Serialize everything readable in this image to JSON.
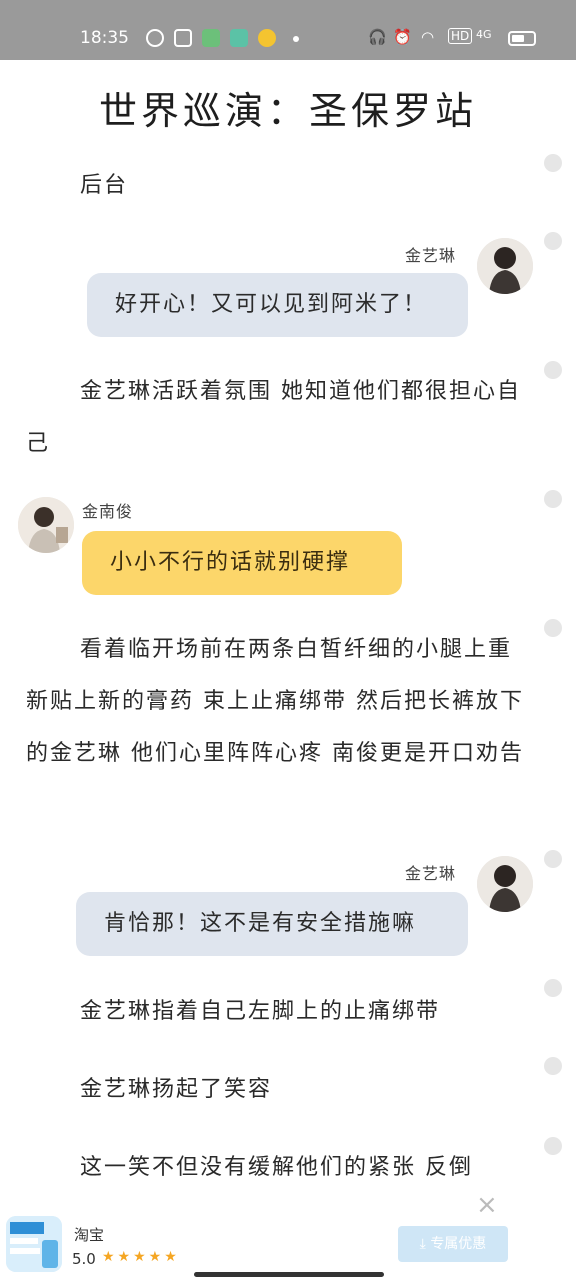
{
  "status_bar": {
    "time": "18:35",
    "network": "HD",
    "signal": "4G"
  },
  "title": "世界巡演：圣保罗站",
  "narrative": {
    "p1": "后台",
    "p2": "金艺琳活跃着氛围 她知道他们都很担心自己",
    "p3": "看着临开场前在两条白皙纤细的小腿上重新贴上新的膏药 束上止痛绑带 然后把长裤放下的金艺琳 他们心里阵阵心疼 南俊更是开口劝告",
    "p4": "金艺琳指着自己左脚上的止痛绑带",
    "p5": "金艺琳扬起了笑容",
    "p6": "这一笑不但没有缓解他们的紧张 反倒"
  },
  "messages": [
    {
      "speaker": "金艺琳",
      "text": "好开心！又可以见到阿米了！",
      "side": "right"
    },
    {
      "speaker": "金南俊",
      "text": "小小不行的话就别硬撑",
      "side": "left"
    },
    {
      "speaker": "金艺琳",
      "text": "肯恰那！这不是有安全措施嘛",
      "side": "right"
    }
  ],
  "ad": {
    "app_name": "淘宝",
    "rating": "5.0",
    "button_label": "专属优惠",
    "close": "×"
  },
  "colors": {
    "right_bubble": "#dfe5ee",
    "left_bubble": "#fcd66a",
    "status_bar": "#9a9a9a"
  }
}
